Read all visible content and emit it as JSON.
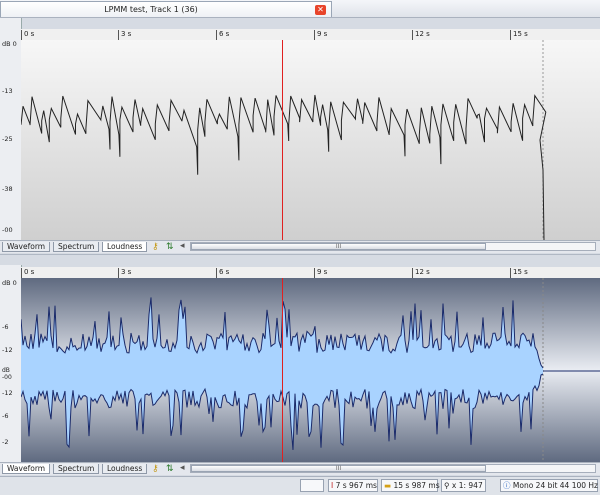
{
  "document_tab": {
    "title": "LPMM test, Track 1 (36)",
    "close_label": "✕"
  },
  "time_ruler": {
    "labels": [
      "0 s",
      "3 s",
      "6 s",
      "9 s",
      "12 s",
      "15 s"
    ]
  },
  "top_pane": {
    "y_labels": [
      "dB 0",
      "-13",
      "-25",
      "-38",
      "-00"
    ],
    "view_tabs": [
      {
        "label": "Waveform"
      },
      {
        "label": "Spectrum"
      },
      {
        "label": "Loudness"
      }
    ],
    "active_tab": "Loudness"
  },
  "bottom_pane": {
    "y_labels": [
      "dB 0",
      "-6",
      "-12",
      "dB -00",
      "-12",
      "-6",
      "-2"
    ],
    "view_tabs": [
      {
        "label": "Waveform"
      },
      {
        "label": "Spectrum"
      },
      {
        "label": "Loudness"
      }
    ],
    "active_tab": "Waveform"
  },
  "scroll_thumb_label": "III",
  "status": {
    "cursor_position": "7 s 967 ms",
    "duration": "15 s 987 ms",
    "zoom": "x 1: 947",
    "format": "Mono 24 bit 44 100 Hz"
  },
  "colors": {
    "cursor": "#e02020",
    "waveform_fill": "#a9d3ff",
    "waveform_edge": "#1a2a6a",
    "loudness_line": "#222222"
  },
  "icons": {
    "key": "key-icon",
    "sync": "sync-arrows-icon",
    "scroll_left": "scroll-left-icon",
    "zoom": "magnifier-icon",
    "info": "info-icon"
  }
}
